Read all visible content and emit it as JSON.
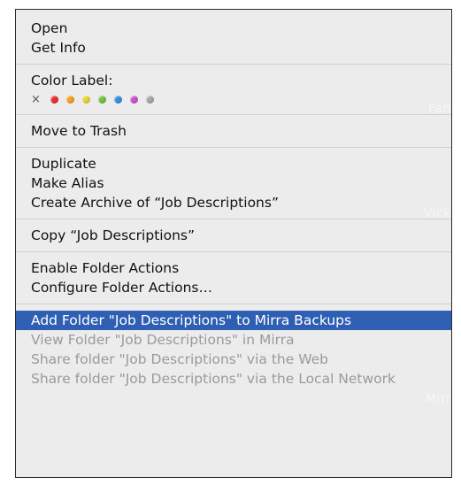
{
  "menu": {
    "group1": [
      {
        "label": "Open"
      },
      {
        "label": "Get Info"
      }
    ],
    "color_label": {
      "heading": "Color Label:",
      "none_symbol": "×",
      "colors": [
        "#e8322f",
        "#f4a121",
        "#e9d52d",
        "#76c043",
        "#3a8fe0",
        "#c755c9",
        "#a7a7a7"
      ]
    },
    "group3": [
      {
        "label": "Move to Trash"
      }
    ],
    "group4": [
      {
        "label": "Duplicate"
      },
      {
        "label": "Make Alias"
      },
      {
        "label": "Create Archive of “Job Descriptions”"
      }
    ],
    "group5": [
      {
        "label": "Copy “Job Descriptions”"
      }
    ],
    "group6": [
      {
        "label": "Enable Folder Actions"
      },
      {
        "label": "Configure Folder Actions…"
      }
    ],
    "group7": [
      {
        "label": "Add Folder \"Job Descriptions\" to Mirra Backups",
        "state": "highlighted"
      },
      {
        "label": "View Folder \"Job Descriptions\" in Mirra",
        "state": "disabled"
      },
      {
        "label": "Share folder \"Job Descriptions\" via the Web",
        "state": "disabled"
      },
      {
        "label": "Share folder \"Job Descriptions\" via the Local Network",
        "state": "disabled"
      }
    ]
  },
  "background_ghost_text": [
    "Fan",
    "Vick",
    "Ord",
    "Mirr"
  ]
}
